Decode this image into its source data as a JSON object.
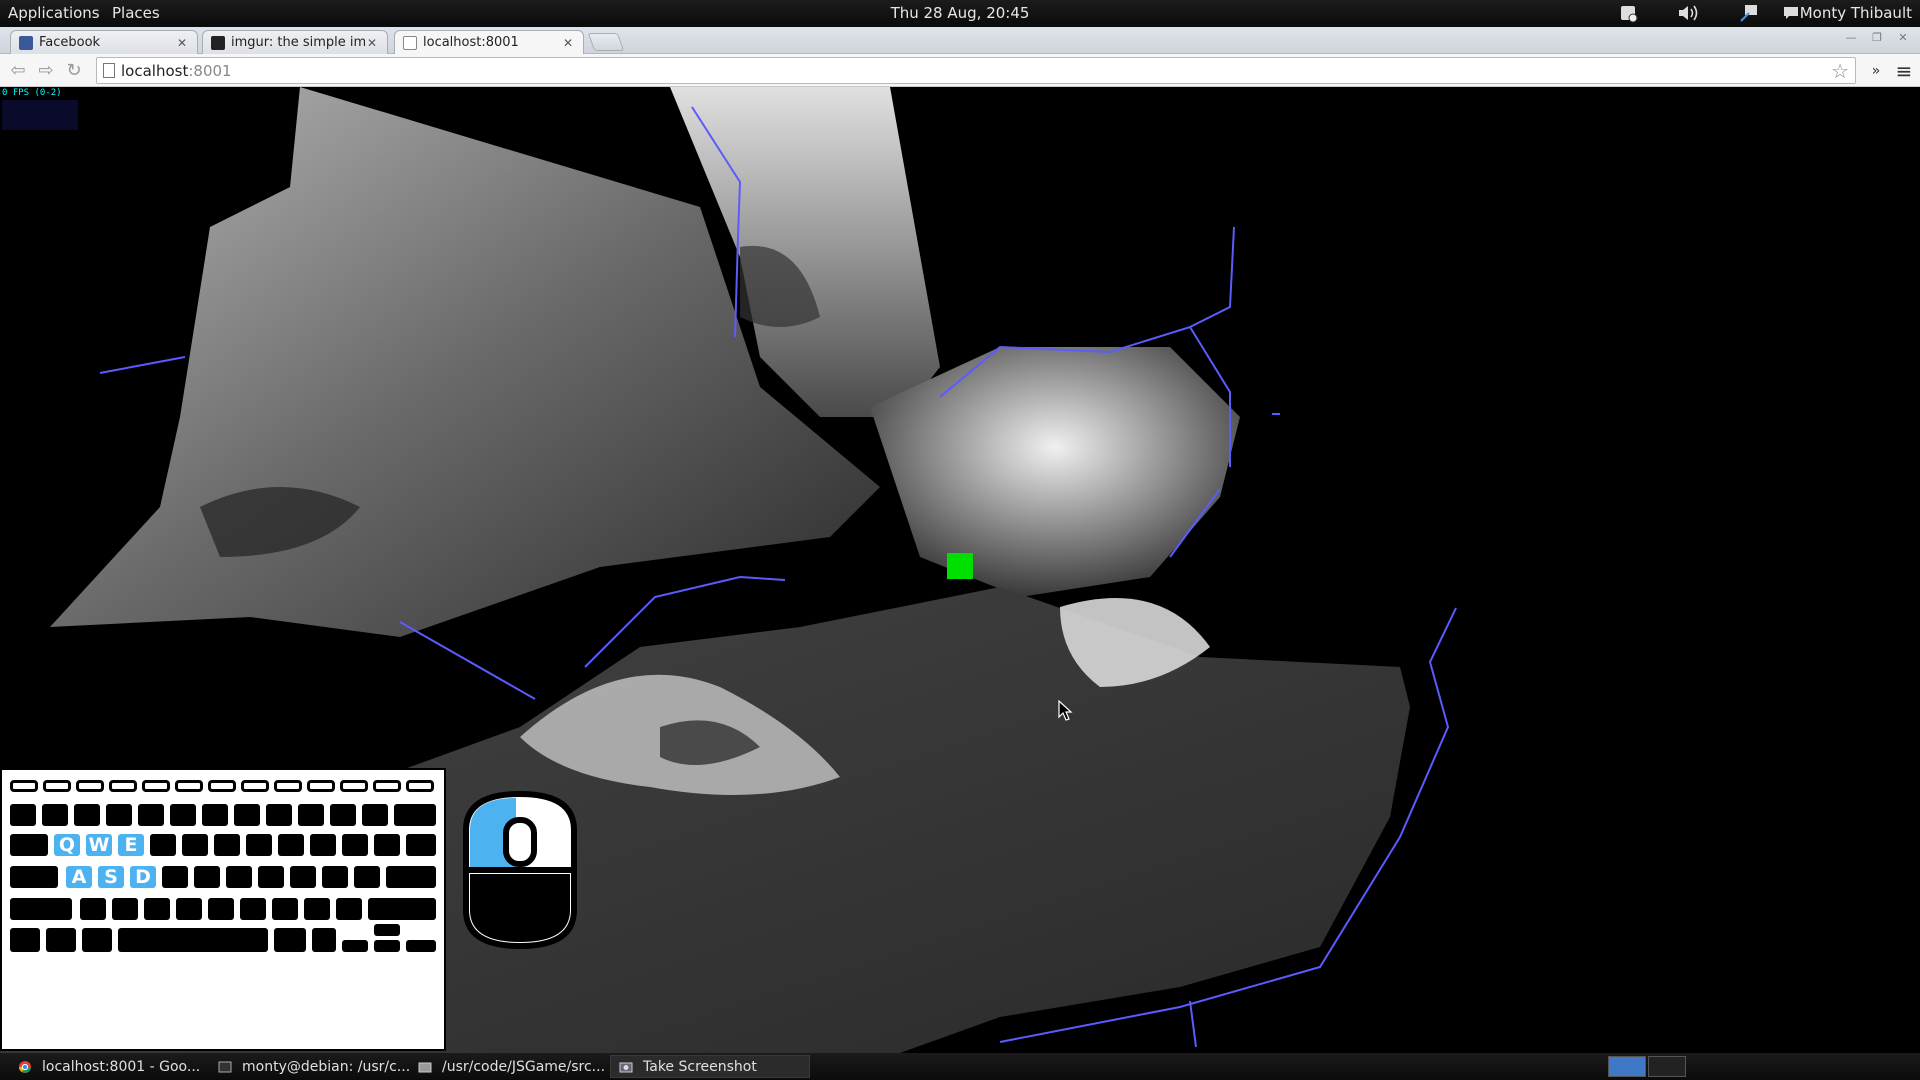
{
  "top_panel": {
    "menu_applications": "Applications",
    "menu_places": "Places",
    "clock": "Thu 28 Aug, 20:45",
    "user": "Monty Thibault",
    "tray_icons": [
      "updates-icon",
      "volume-icon",
      "network-icon",
      "chat-icon"
    ]
  },
  "browser": {
    "tabs": [
      {
        "label": "Facebook",
        "icon": "facebook-icon",
        "active": false
      },
      {
        "label": "imgur: the simple imag",
        "icon": "imgur-icon",
        "active": false
      },
      {
        "label": "localhost:8001",
        "icon": "page-icon",
        "active": true
      }
    ],
    "url_host": "localhost",
    "url_port": ":8001",
    "overflow_label": "»",
    "menu_glyph": "≡"
  },
  "game": {
    "fps_text": "0 FPS (0-2)",
    "active_keys": [
      "Q",
      "W",
      "E",
      "A",
      "S",
      "D"
    ],
    "mouse_active_button": "left",
    "colors": {
      "player": "#00e000",
      "key_active": "#4db2f0",
      "wireframe": "#5b5bff"
    }
  },
  "taskbar": {
    "items": [
      {
        "label": "localhost:8001 - Goo...",
        "icon": "chrome-icon",
        "active": false
      },
      {
        "label": "monty@debian: /usr/c...",
        "icon": "terminal-icon",
        "active": false
      },
      {
        "label": "/usr/code/JSGame/src...",
        "icon": "folder-icon",
        "active": false
      },
      {
        "label": "Take Screenshot",
        "icon": "screenshot-icon",
        "active": true
      }
    ]
  }
}
